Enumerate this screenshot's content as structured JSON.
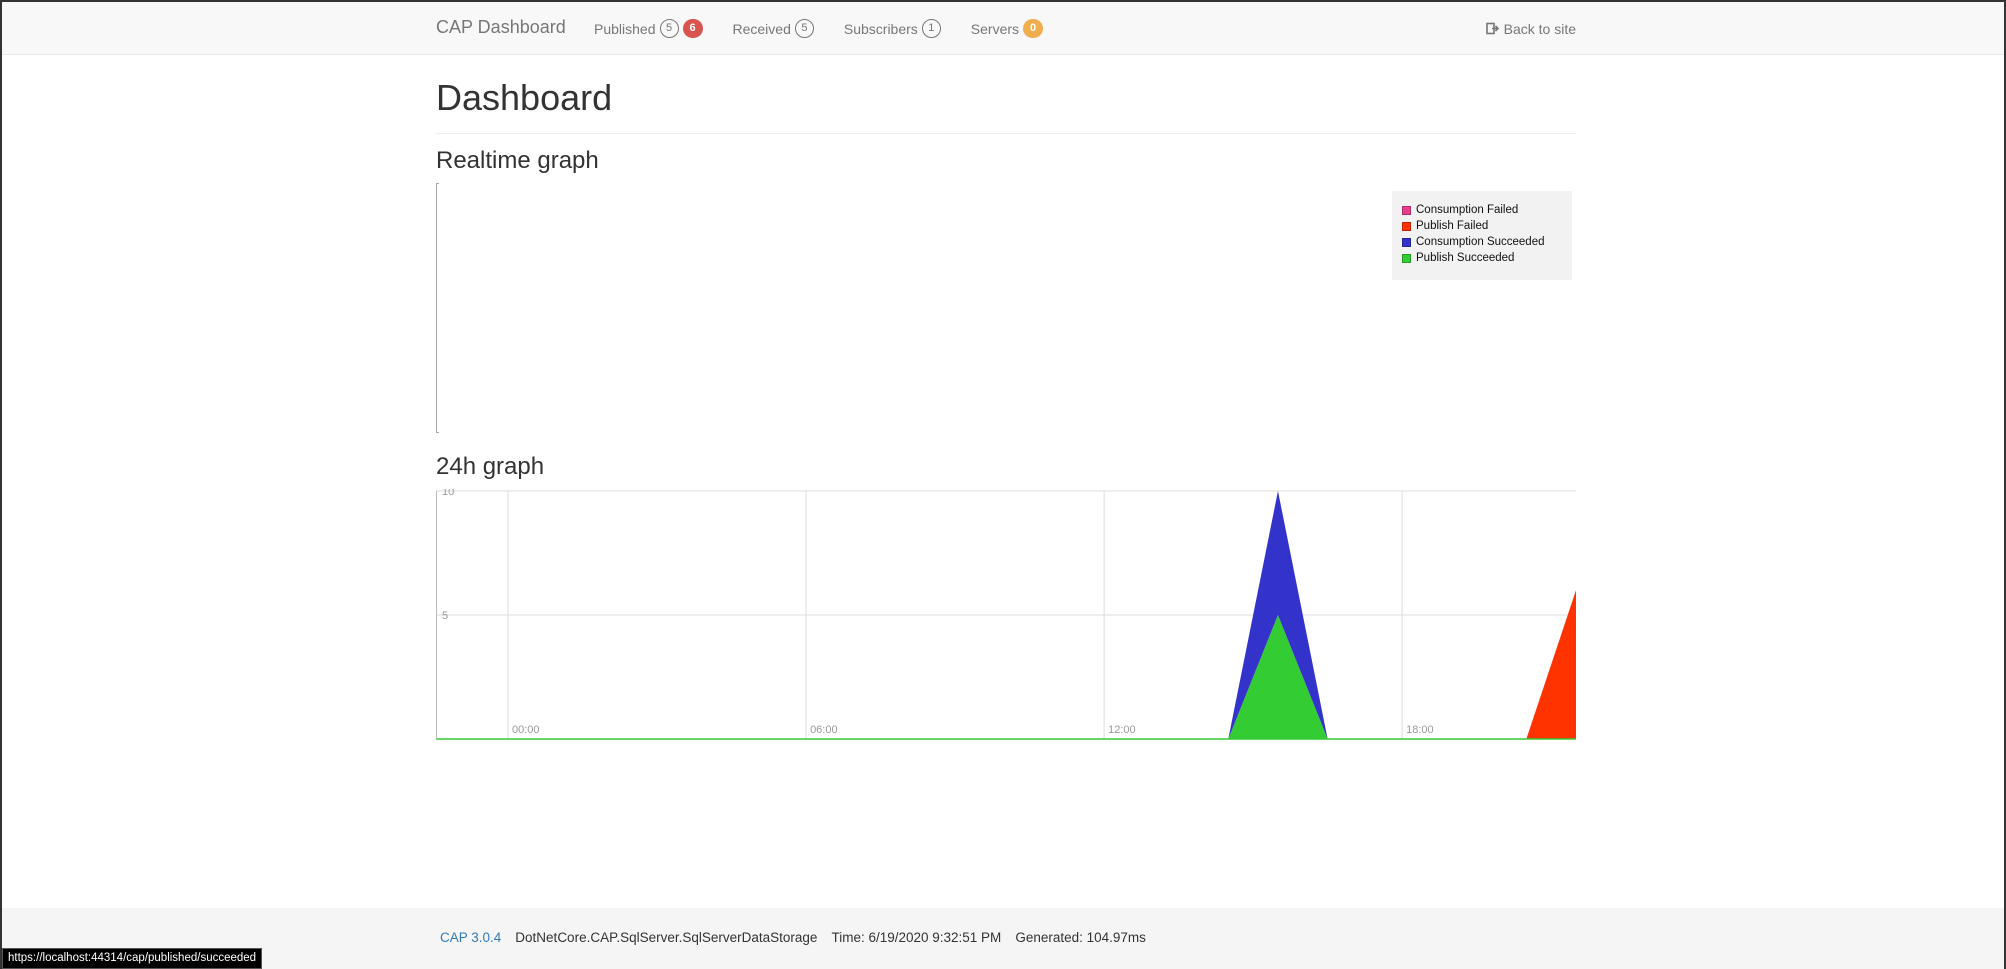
{
  "nav": {
    "brand": "CAP Dashboard",
    "items": [
      {
        "label": "Published",
        "counts": [
          {
            "value": "5",
            "style": "outline",
            "color": "#777777"
          },
          {
            "value": "6",
            "style": "fill",
            "color": "#d9534f"
          }
        ]
      },
      {
        "label": "Received",
        "counts": [
          {
            "value": "5",
            "style": "outline",
            "color": "#777777"
          }
        ]
      },
      {
        "label": "Subscribers",
        "counts": [
          {
            "value": "1",
            "style": "outline",
            "color": "#777777"
          }
        ]
      },
      {
        "label": "Servers",
        "counts": [
          {
            "value": "0",
            "style": "fill",
            "color": "#f0ad4e"
          }
        ]
      }
    ],
    "back_label": "Back to site",
    "back_icon": "sign-out-icon"
  },
  "page": {
    "title": "Dashboard",
    "realtime_title": "Realtime graph",
    "graph24_title": "24h graph"
  },
  "legend": [
    {
      "label": "Consumption Failed",
      "color": "#e83e8c"
    },
    {
      "label": "Publish Failed",
      "color": "#ff3300"
    },
    {
      "label": "Consumption Succeeded",
      "color": "#3333cc"
    },
    {
      "label": "Publish Succeeded",
      "color": "#33cc33"
    }
  ],
  "chart_data": [
    {
      "type": "area",
      "series": [
        {
          "name": "Consumption Failed",
          "values": []
        },
        {
          "name": "Publish Failed",
          "values": []
        },
        {
          "name": "Consumption Succeeded",
          "values": []
        },
        {
          "name": "Publish Succeeded",
          "values": []
        }
      ],
      "legend": "top-right"
    },
    {
      "type": "area",
      "stacked": true,
      "x_ticks": [
        "00:00",
        "06:00",
        "12:00",
        "18:00"
      ],
      "y_ticks": [
        5,
        10
      ],
      "ylim": [
        0,
        10
      ],
      "xlim_hours": [
        -1.45,
        21.5
      ],
      "grid": true,
      "series": [
        {
          "name": "Publish Succeeded",
          "color": "#33cc33",
          "points": [
            [
              14.5,
              0
            ],
            [
              15.5,
              5
            ],
            [
              16.5,
              0
            ]
          ]
        },
        {
          "name": "Consumption Succeeded",
          "color": "#3333cc",
          "points": [
            [
              14.5,
              0
            ],
            [
              15.5,
              5
            ],
            [
              16.5,
              0
            ]
          ]
        },
        {
          "name": "Publish Failed",
          "color": "#ff3300",
          "points": [
            [
              20.5,
              0
            ],
            [
              21.5,
              6
            ]
          ]
        },
        {
          "name": "Consumption Failed",
          "color": "#e83e8c",
          "points": []
        }
      ]
    }
  ],
  "footer": {
    "version": "CAP 3.0.4",
    "storage": "DotNetCore.CAP.SqlServer.SqlServerDataStorage",
    "time": "Time: 6/19/2020 9:32:51 PM",
    "generated": "Generated: 104.97ms"
  },
  "status_url": "https://localhost:44314/cap/published/succeeded"
}
